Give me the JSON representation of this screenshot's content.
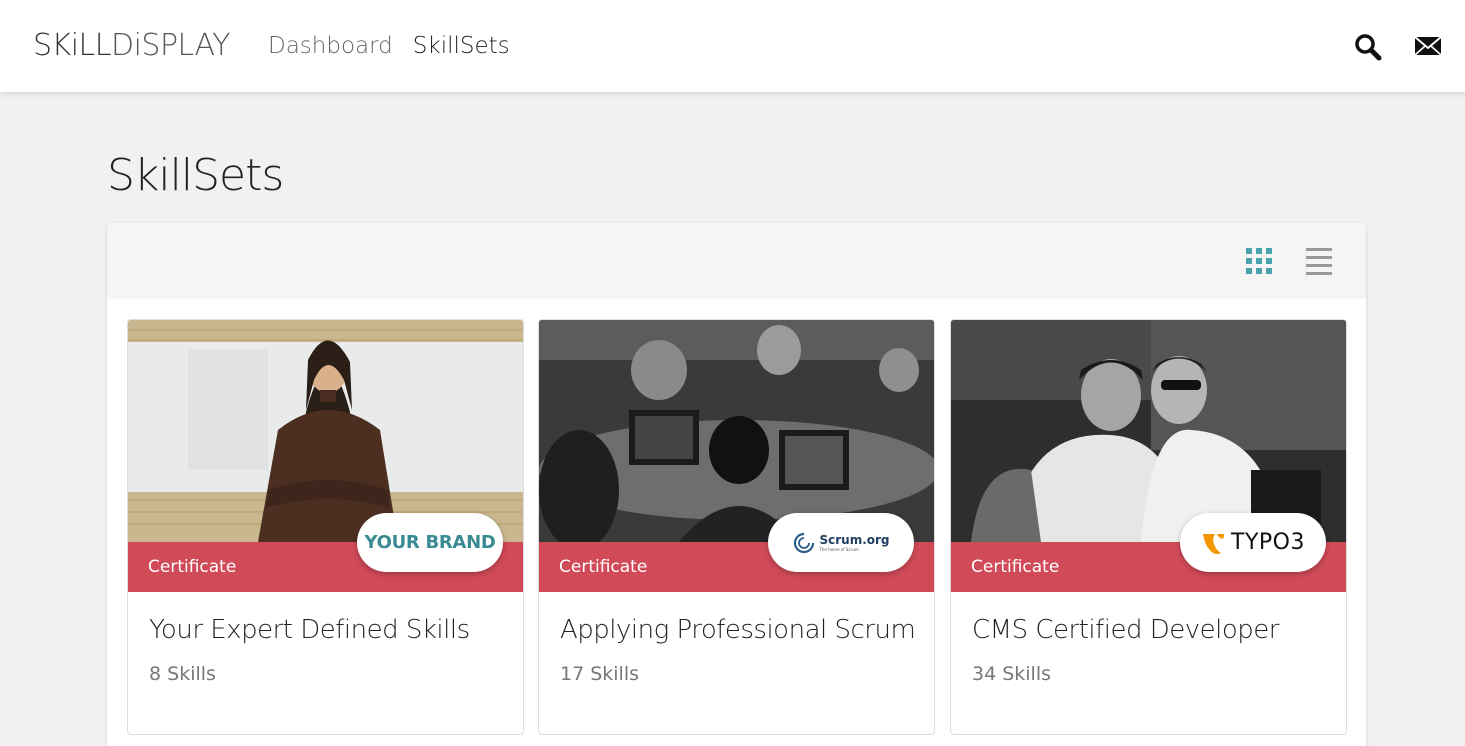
{
  "header": {
    "logo_part1": "SKiLL",
    "logo_part2": "DiSPLAY",
    "nav": [
      {
        "label": "Dashboard",
        "active": false
      },
      {
        "label": "SkillSets",
        "active": true
      }
    ],
    "icons": [
      "search-icon",
      "mail-icon"
    ]
  },
  "page": {
    "title": "SkillSets"
  },
  "toolbar": {
    "views": [
      "grid-view-icon",
      "list-view-icon"
    ],
    "active_view": "grid",
    "active_color": "#4aa3a8",
    "inactive_color": "#999999"
  },
  "cards": [
    {
      "category": "Certificate",
      "badge_text": "YOUR BRAND",
      "title": "Your Expert Defined Skills",
      "count": "8 Skills"
    },
    {
      "category": "Certificate",
      "badge_text": "Scrum.org",
      "badge_subtext": "The home of Scrum",
      "title": "Applying Professional Scrum",
      "count": "17 Skills"
    },
    {
      "category": "Certificate",
      "badge_text": "TYPO3",
      "title": "CMS Certified Developer",
      "count": "34 Skills"
    }
  ],
  "colors": {
    "band": "#d04a58",
    "brand_teal": "#3a8a94",
    "typo3_orange": "#f49700"
  }
}
